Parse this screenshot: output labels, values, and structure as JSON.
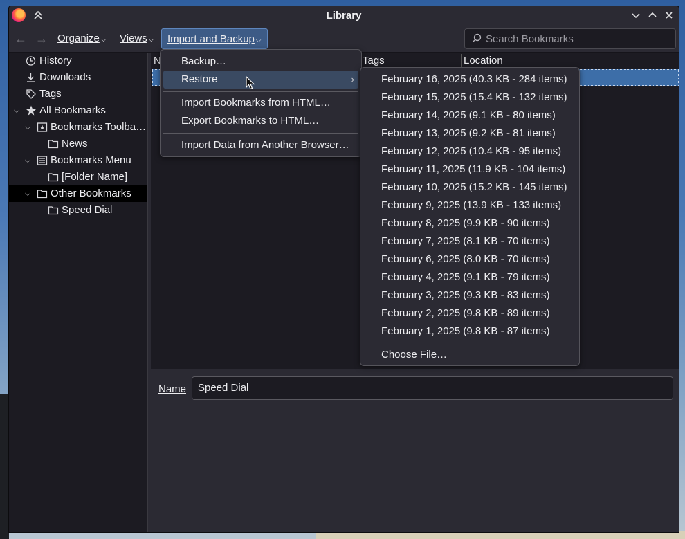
{
  "window": {
    "title": "Library"
  },
  "toolbar": {
    "organize": "Organize",
    "views": "Views",
    "import_backup": "Import and Backup",
    "search_placeholder": "Search Bookmarks"
  },
  "sidebar": {
    "items": [
      {
        "label": "History",
        "icon": "clock-icon"
      },
      {
        "label": "Downloads",
        "icon": "download-icon"
      },
      {
        "label": "Tags",
        "icon": "tag-icon"
      },
      {
        "label": "All Bookmarks",
        "icon": "star-icon"
      },
      {
        "label": "Bookmarks Toolba…",
        "icon": "toolbar-folder-icon"
      },
      {
        "label": "News",
        "icon": "folder-icon"
      },
      {
        "label": "Bookmarks Menu",
        "icon": "menu-folder-icon"
      },
      {
        "label": "[Folder Name]",
        "icon": "folder-icon"
      },
      {
        "label": "Other Bookmarks",
        "icon": "folder-icon"
      },
      {
        "label": "Speed Dial",
        "icon": "folder-icon"
      }
    ]
  },
  "columns": {
    "name": "N",
    "tags": "Tags",
    "location": "Location"
  },
  "details": {
    "name_label": "Name",
    "name_value": "Speed Dial"
  },
  "import_menu": {
    "items": [
      "Backup…",
      "Restore",
      "Import Bookmarks from HTML…",
      "Export Bookmarks to HTML…",
      "Import Data from Another Browser…"
    ]
  },
  "restore_menu": {
    "items": [
      "February 16, 2025 (40.3 KB - 284 items)",
      "February 15, 2025 (15.4 KB - 132 items)",
      "February 14, 2025 (9.1 KB - 80 items)",
      "February 13, 2025 (9.2 KB - 81 items)",
      "February 12, 2025 (10.4 KB - 95 items)",
      "February 11, 2025 (11.9 KB - 104 items)",
      "February 10, 2025 (15.2 KB - 145 items)",
      "February 9, 2025 (13.9 KB - 133 items)",
      "February 8, 2025 (9.9 KB - 90 items)",
      "February 7, 2025 (8.1 KB - 70 items)",
      "February 6, 2025 (8.0 KB - 70 items)",
      "February 4, 2025 (9.1 KB - 79 items)",
      "February 3, 2025 (9.3 KB - 83 items)",
      "February 2, 2025 (9.8 KB - 89 items)",
      "February 1, 2025 (9.8 KB - 87 items)"
    ],
    "choose_file": "Choose File…"
  }
}
